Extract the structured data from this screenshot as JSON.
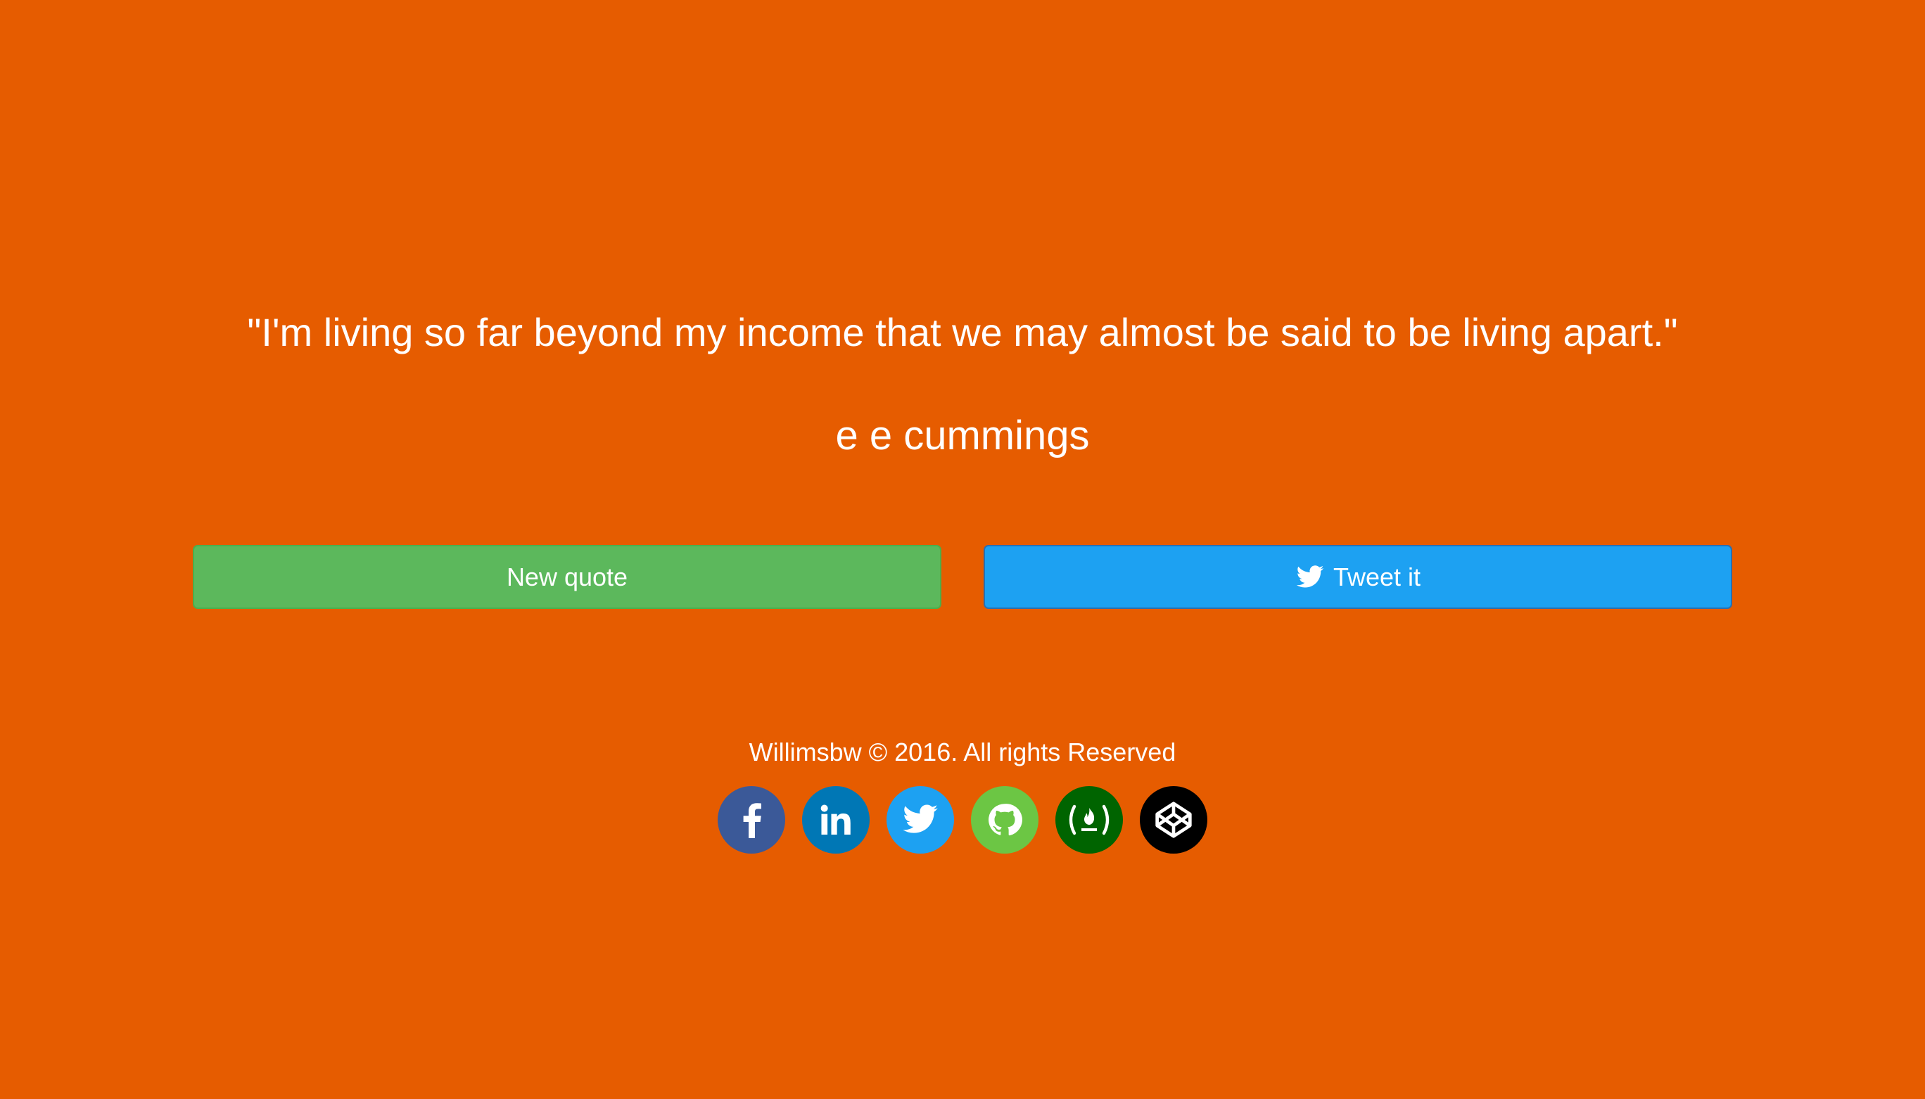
{
  "quote": {
    "text": "\"I'm living so far beyond my income that we may almost be said to be living apart.\"",
    "author": "e e cummings"
  },
  "buttons": {
    "new_quote_label": "New quote",
    "tweet_label": "Tweet it"
  },
  "footer": {
    "copyright": "Willimsbw © 2016. All rights Reserved"
  },
  "socials": [
    {
      "icon": "facebook-icon",
      "color": "#3B5998"
    },
    {
      "icon": "linkedin-icon",
      "color": "#0077B5"
    },
    {
      "icon": "twitter-icon",
      "color": "#1DA1F2"
    },
    {
      "icon": "github-icon",
      "color": "#6CC644"
    },
    {
      "icon": "freecodecamp-icon",
      "color": "#006400"
    },
    {
      "icon": "codepen-icon",
      "color": "#000000"
    }
  ],
  "colors": {
    "background": "#E65C00",
    "new_quote_button": "#5CB85C",
    "tweet_button": "#1DA1F2",
    "text": "#FFFFFF"
  }
}
